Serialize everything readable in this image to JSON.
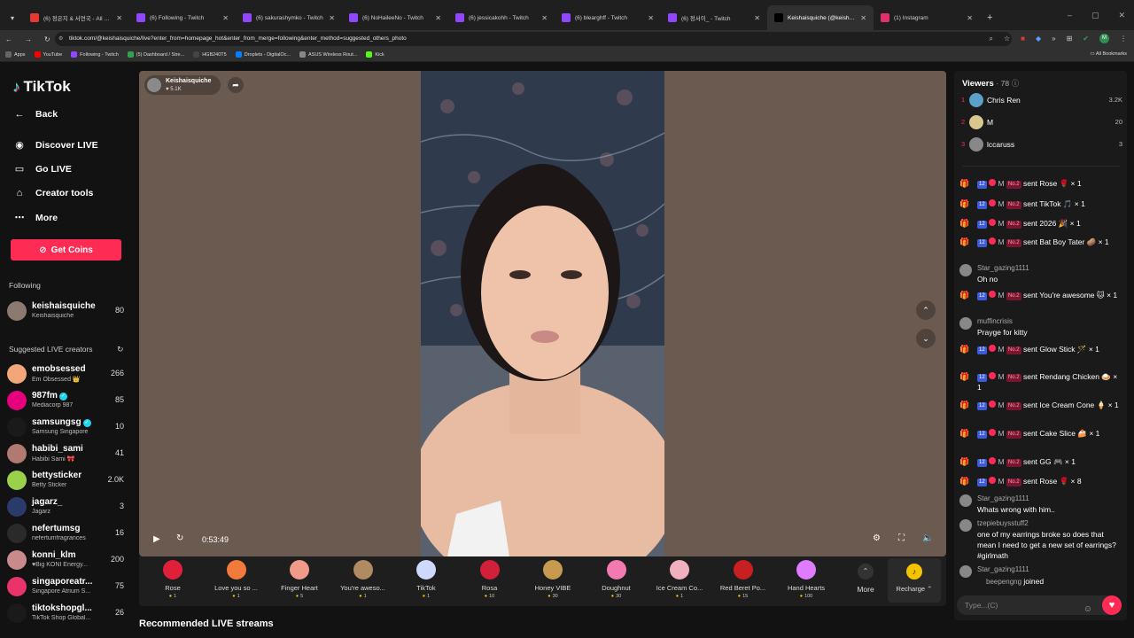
{
  "browser": {
    "tabs": [
      {
        "title": "(6) 정은지 & 서연국 - All For You",
        "color": "#e53935",
        "active": false
      },
      {
        "title": "(6) Following - Twitch",
        "color": "#9146ff",
        "active": false
      },
      {
        "title": "(6) sakurashymko - Twitch",
        "color": "#9146ff",
        "active": false
      },
      {
        "title": "(6) NoHaileeNo - Twitch",
        "color": "#9146ff",
        "active": false
      },
      {
        "title": "(6) jessicakohh - Twitch",
        "color": "#9146ff",
        "active": false
      },
      {
        "title": "(6) blearghff - Twitch",
        "color": "#9146ff",
        "active": false
      },
      {
        "title": "(6) 정서이_ - Twitch",
        "color": "#9146ff",
        "active": false
      },
      {
        "title": "Keishaisquiche (@keishaisquiche)",
        "color": "#000000",
        "active": true
      },
      {
        "title": "(1) Instagram",
        "color": "#e1306c",
        "active": false
      }
    ],
    "url": "tiktok.com/@keishaisquiche/live?enter_from=homepage_hot&enter_from_merge=following&enter_method=suggested_others_photo",
    "bookmarks": [
      {
        "label": "Apps",
        "color": "#666666"
      },
      {
        "label": "YouTube",
        "color": "#ff0000"
      },
      {
        "label": "Following - Twitch",
        "color": "#9146ff"
      },
      {
        "label": "(5) Dashboard / Stre...",
        "color": "#2ea44f"
      },
      {
        "label": "HGB240T5",
        "color": "#444444"
      },
      {
        "label": "Droplets - DigitalOc...",
        "color": "#0080ff"
      },
      {
        "label": "ASUS Wireless Rout...",
        "color": "#888888"
      },
      {
        "label": "Kick",
        "color": "#53fc18"
      }
    ],
    "all_bookmarks": "All Bookmarks",
    "profile_initial": "M"
  },
  "sidebar": {
    "logo": "TikTok",
    "nav": [
      {
        "label": "Back",
        "icon": "back-arrow-icon",
        "glyph": "←"
      },
      {
        "label": "Discover LIVE",
        "icon": "discover-live-icon",
        "glyph": "◉"
      },
      {
        "label": "Go LIVE",
        "icon": "camera-icon",
        "glyph": "▭"
      },
      {
        "label": "Creator tools",
        "icon": "home-icon",
        "glyph": "⌂"
      },
      {
        "label": "More",
        "icon": "more-icon",
        "glyph": "⋯"
      }
    ],
    "get_coins": "Get Coins",
    "following_label": "Following",
    "following": [
      {
        "name": "keishaisquiche",
        "sub": "Keishaisquiche",
        "count": "80",
        "color": "#8a7a70"
      }
    ],
    "suggested_label": "Suggested LIVE creators",
    "suggested": [
      {
        "name": "emobsessed",
        "sub": "Em Obsessed 👑",
        "count": "266",
        "color": "#f2a679",
        "verified": false
      },
      {
        "name": "987fm",
        "sub": "Mediacorp 987",
        "count": "85",
        "color": "#e6007e",
        "verified": true
      },
      {
        "name": "samsungsg",
        "sub": "Samsung Singapore",
        "count": "10",
        "color": "#1a1a1a",
        "verified": true
      },
      {
        "name": "habibi_sami",
        "sub": "Habibi Sami 🎀",
        "count": "41",
        "color": "#b07a70",
        "verified": false
      },
      {
        "name": "bettysticker",
        "sub": "Betty Sticker",
        "count": "2.0K",
        "color": "#9ad04a",
        "verified": false
      },
      {
        "name": "jagarz_",
        "sub": "Jagarz",
        "count": "3",
        "color": "#2a3a6a",
        "verified": false
      },
      {
        "name": "nefertumsg",
        "sub": "nefertumfragrances",
        "count": "16",
        "color": "#2a2a2a",
        "verified": false
      },
      {
        "name": "konni_klm",
        "sub": "♥Big KONI Energy...",
        "count": "200",
        "color": "#c88a8a",
        "verified": false
      },
      {
        "name": "singaporeatr...",
        "sub": "Singapore Atrium S...",
        "count": "75",
        "color": "#e8336b",
        "verified": false
      },
      {
        "name": "tiktokshopgl...",
        "sub": "TikTok Shop Global...",
        "count": "26",
        "color": "#1a1a1a",
        "verified": false
      }
    ]
  },
  "stream": {
    "host_name": "Keishaisquiche",
    "host_likes": "5.1K",
    "elapsed": "0:53:49",
    "background_color": "#6b5a4f"
  },
  "gifts": [
    {
      "name": "Rose",
      "price": "1",
      "color": "#e0203a"
    },
    {
      "name": "Love you so ...",
      "price": "1",
      "color": "#f27a3a"
    },
    {
      "name": "Finger Heart",
      "price": "5",
      "color": "#f29a8a"
    },
    {
      "name": "You're aweso...",
      "price": "1",
      "color": "#b08a60"
    },
    {
      "name": "TikTok",
      "price": "1",
      "color": "#cfd8ff"
    },
    {
      "name": "Rosa",
      "price": "10",
      "color": "#d0203a"
    },
    {
      "name": "Honey VIBE",
      "price": "30",
      "color": "#c89a50"
    },
    {
      "name": "Doughnut",
      "price": "30",
      "color": "#f27ab0"
    },
    {
      "name": "Ice Cream Co...",
      "price": "1",
      "color": "#f0b0c0"
    },
    {
      "name": "Red Beret Po...",
      "price": "15",
      "color": "#c82020"
    },
    {
      "name": "Hand Hearts",
      "price": "100",
      "color": "#e07aff"
    }
  ],
  "more_label": "More",
  "recharge_label": "Recharge",
  "recommended_label": "Recommended LIVE streams",
  "viewers": {
    "title": "Viewers",
    "count": "78",
    "top": [
      {
        "rank": "1",
        "name": "Chris Ren",
        "score": "3.2K",
        "color": "#5aa0c8"
      },
      {
        "rank": "2",
        "name": "M",
        "score": "20",
        "color": "#d8c890"
      },
      {
        "rank": "3",
        "name": "lccaruss",
        "score": "3",
        "color": "#888888"
      }
    ]
  },
  "chat": [
    {
      "type": "gift",
      "user": "M",
      "text": "sent Rose 🌹 × 1"
    },
    {
      "type": "gift",
      "user": "M",
      "text": "sent TikTok 🎵 × 1"
    },
    {
      "type": "gift",
      "user": "M",
      "text": "sent 2026 🎉 × 1"
    },
    {
      "type": "gift",
      "user": "M",
      "text": "sent Bat Boy Tater 🥔 × 1"
    },
    {
      "type": "msg",
      "user": "Star_gazing1111",
      "text": "Oh no"
    },
    {
      "type": "gift",
      "user": "M",
      "text": "sent You're awesome 🐱 × 1"
    },
    {
      "type": "msg",
      "user": "muffincrisis",
      "text": "Prayge for kitty"
    },
    {
      "type": "gift",
      "user": "M",
      "text": "sent Glow Stick 🪄 × 1"
    },
    {
      "type": "gift",
      "user": "M",
      "text": "sent Rendang Chicken 🍛 × 1"
    },
    {
      "type": "gift",
      "user": "M",
      "text": "sent Ice Cream Cone 🍦 × 1"
    },
    {
      "type": "gift",
      "user": "M",
      "text": "sent Cake Slice 🍰 × 1"
    },
    {
      "type": "gift",
      "user": "M",
      "text": "sent GG 🎮 × 1"
    },
    {
      "type": "gift",
      "user": "M",
      "text": "sent Rose 🌹 × 8"
    },
    {
      "type": "msg",
      "user": "Star_gazing1111",
      "text": "Whats wrong with him.."
    },
    {
      "type": "msg",
      "user": "tzepiebuysstuff2",
      "text": "one of my earrings broke so does that mean I need to get a new set of earrings? #girlmath"
    },
    {
      "type": "msg",
      "user": "Star_gazing1111",
      "text": ""
    },
    {
      "type": "join",
      "user": "beepengng",
      "text": "joined"
    }
  ],
  "badges": {
    "level": "12",
    "rank": "No.2"
  },
  "chat_input_placeholder": "Type...(C)"
}
